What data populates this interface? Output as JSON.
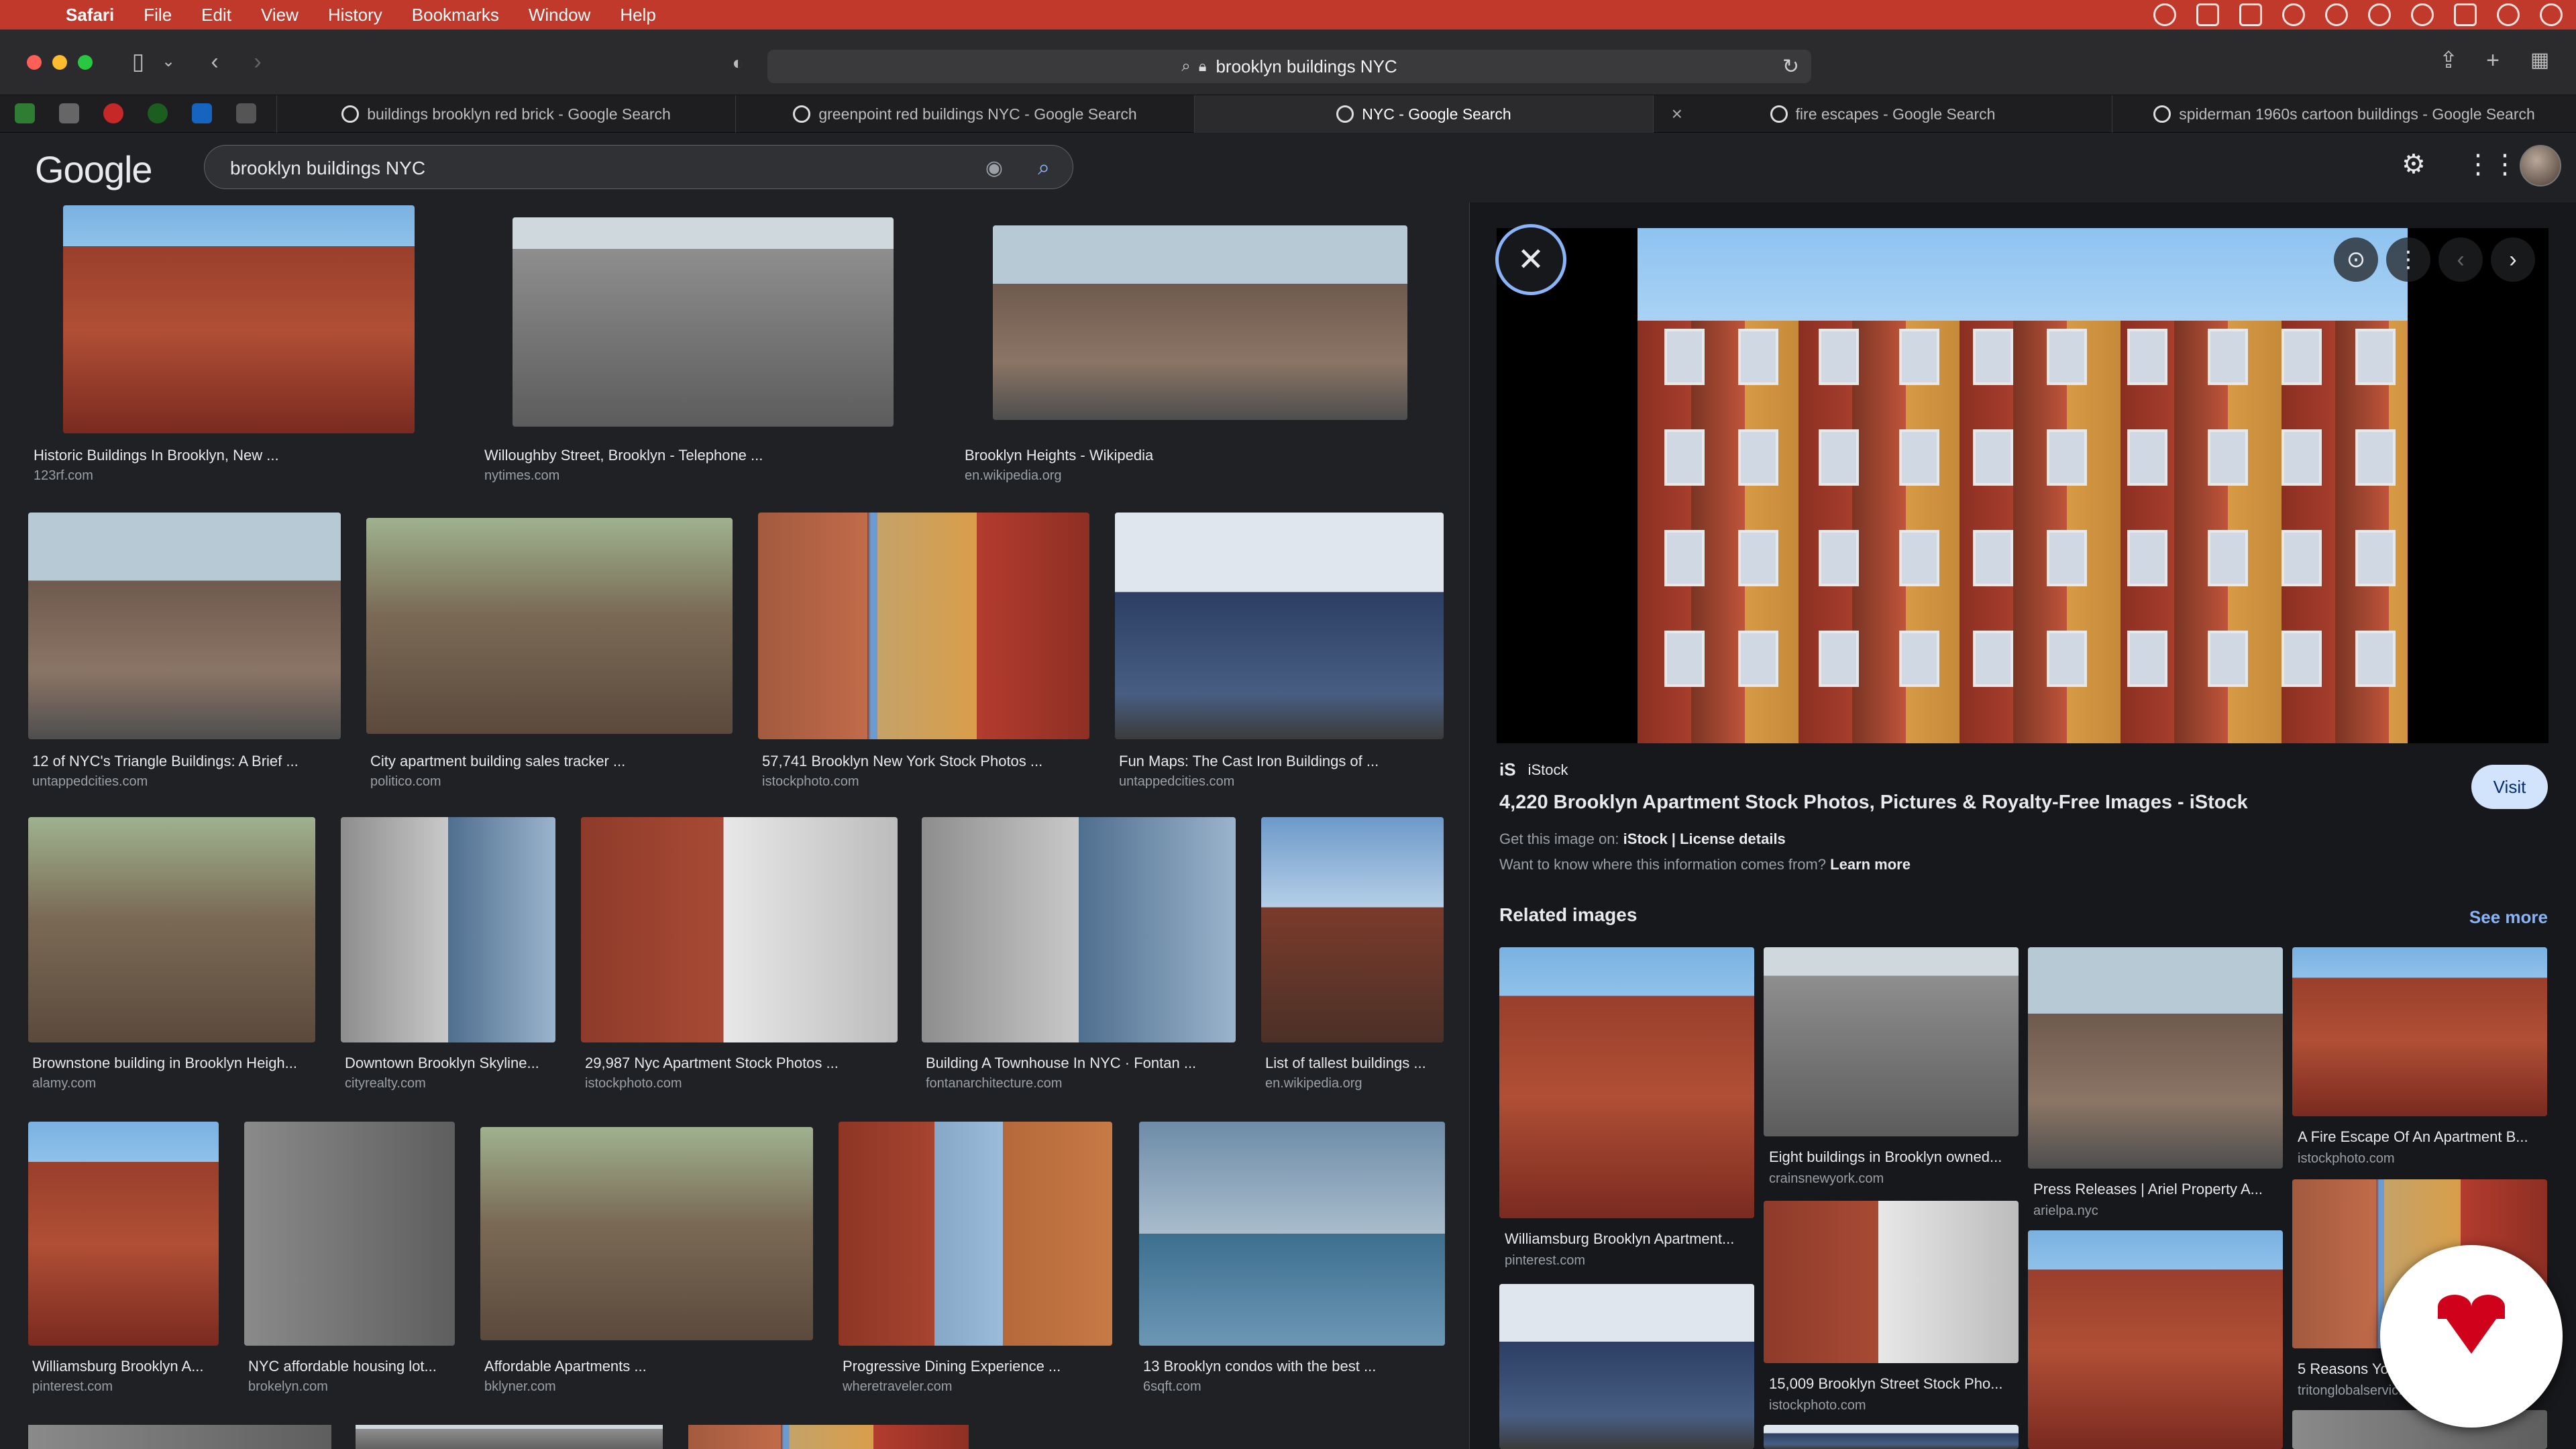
{
  "menubar": {
    "items": [
      "Safari",
      "File",
      "Edit",
      "View",
      "History",
      "Bookmarks",
      "Window",
      "Help"
    ]
  },
  "toolbar": {
    "url": "brooklyn buildings NYC"
  },
  "tabs": [
    {
      "label": "buildings brooklyn red brick - Google Search",
      "active": false
    },
    {
      "label": "greenpoint red buildings NYC - Google Search",
      "active": false
    },
    {
      "label": "NYC - Google Search",
      "active": true
    },
    {
      "label": "fire escapes - Google Search",
      "active": false
    },
    {
      "label": "spiderman 1960s cartoon buildings - Google Search",
      "active": false
    }
  ],
  "google": {
    "logo": "Google",
    "query": "brooklyn buildings NYC"
  },
  "results": [
    {
      "title": "Historic Buildings In Brooklyn, New ...",
      "source": "123rf.com"
    },
    {
      "title": "Willoughby Street, Brooklyn - Telephone ...",
      "source": "nytimes.com"
    },
    {
      "title": "Brooklyn Heights - Wikipedia",
      "source": "en.wikipedia.org"
    },
    {
      "title": "12 of NYC's Triangle Buildings: A Brief ...",
      "source": "untappedcities.com"
    },
    {
      "title": "City apartment building sales tracker ...",
      "source": "politico.com"
    },
    {
      "title": "57,741 Brooklyn New York Stock Photos ...",
      "source": "istockphoto.com"
    },
    {
      "title": "Fun Maps: The Cast Iron Buildings of ...",
      "source": "untappedcities.com"
    },
    {
      "title": "Brownstone building in Brooklyn Heigh...",
      "source": "alamy.com"
    },
    {
      "title": "Downtown Brooklyn Skyline...",
      "source": "cityrealty.com"
    },
    {
      "title": "29,987 Nyc Apartment Stock Photos ...",
      "source": "istockphoto.com"
    },
    {
      "title": "Building A Townhouse In NYC · Fontan ...",
      "source": "fontanarchitecture.com"
    },
    {
      "title": "List of tallest buildings ...",
      "source": "en.wikipedia.org"
    },
    {
      "title": "Williamsburg Brooklyn A...",
      "source": "pinterest.com"
    },
    {
      "title": "NYC affordable housing lot...",
      "source": "brokelyn.com"
    },
    {
      "title": "Affordable Apartments ...",
      "source": "bklyner.com"
    },
    {
      "title": "Progressive Dining Experience ...",
      "source": "wheretraveler.com"
    },
    {
      "title": "13 Brooklyn condos with the best ...",
      "source": "6sqft.com"
    }
  ],
  "panel": {
    "source_logo": "iS",
    "source_name": "iStock",
    "title": "4,220 Brooklyn Apartment Stock Photos, Pictures & Royalty-Free Images - iStock",
    "visit_label": "Visit",
    "get_prefix": "Get this image on: ",
    "get_link": "iStock | License details",
    "want_prefix": "Want to know where this information comes from? ",
    "want_link": "Learn more",
    "related_heading": "Related images",
    "see_more": "See more",
    "related": [
      {
        "title": "Williamsburg Brooklyn Apartment...",
        "source": "pinterest.com"
      },
      {
        "title": "Eight buildings in Brooklyn owned...",
        "source": "crainsnewyork.com"
      },
      {
        "title": "Press Releases | Ariel Property A...",
        "source": "arielpa.nyc"
      },
      {
        "title": "A Fire Escape Of An Apartment B...",
        "source": "istockphoto.com"
      },
      {
        "title": "15,009 Brooklyn Street Stock Pho...",
        "source": "istockphoto.com"
      },
      {
        "title": "5 Reasons Yo...",
        "source": "tritonglobalservic..."
      }
    ]
  },
  "colors": {
    "menubar": "#c0392b",
    "google_bg": "#202124",
    "link_blue": "#8ab4f8",
    "visit_bg": "#d2e3fc"
  },
  "icons": {
    "apple": "apple-icon",
    "back": "chevron-left-icon",
    "forward": "chevron-right-icon",
    "sidebar": "sidebar-icon",
    "share": "share-icon",
    "new_tab": "plus-icon",
    "tab_overview": "grid-icon",
    "settings": "gear-icon",
    "apps": "apps-grid-icon",
    "camera": "camera-icon",
    "search": "search-icon",
    "close": "close-icon"
  }
}
